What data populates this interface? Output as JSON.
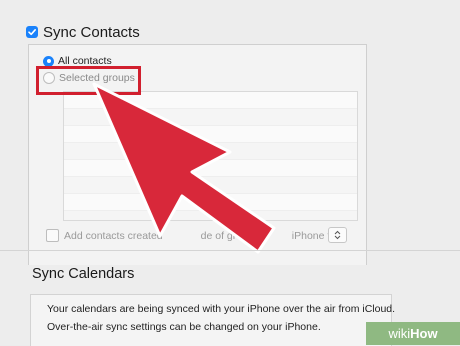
{
  "contacts": {
    "title": "Sync Contacts",
    "all_contacts_label": "All contacts",
    "selected_groups_label": "Selected groups",
    "group_rows_count": 8,
    "add_contacts_prefix": "Add contacts created",
    "add_contacts_middle": "de of group",
    "add_contacts_suffix": "iPhone to:"
  },
  "calendars": {
    "title": "Sync Calendars",
    "line1": "Your calendars are being synced with your iPhone over the air from iCloud.",
    "line2": "Over-the-air sync settings can be changed on your iPhone."
  },
  "watermark": {
    "part1": "wiki",
    "part2": "How"
  },
  "colors": {
    "accent": "#1a82fb",
    "highlight": "#d11f2e",
    "arrow": "#d8283a"
  }
}
